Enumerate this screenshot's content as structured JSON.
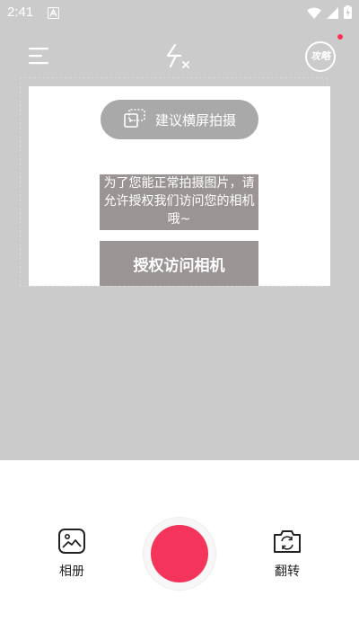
{
  "status_bar": {
    "time": "2:41",
    "notification_icon": "a-notification-icon",
    "wifi_icon": "wifi-icon",
    "signal_icon": "signal-icon",
    "battery_icon": "battery-charging-icon"
  },
  "top_bar": {
    "menu_icon": "menu-icon",
    "flash_icon": "flash-off-icon",
    "guide_label": "攻略",
    "guide_badge_color": "#ff3355"
  },
  "preview": {
    "landscape_hint": "建议横屏拍摄",
    "permission_message": "为了您能正常拍摄图片，请允许授权我们访问您的相机哦~",
    "authorize_button": "授权访问相机"
  },
  "bottom": {
    "album_label": "相册",
    "flip_label": "翻转",
    "shutter_color": "#f4345a"
  }
}
